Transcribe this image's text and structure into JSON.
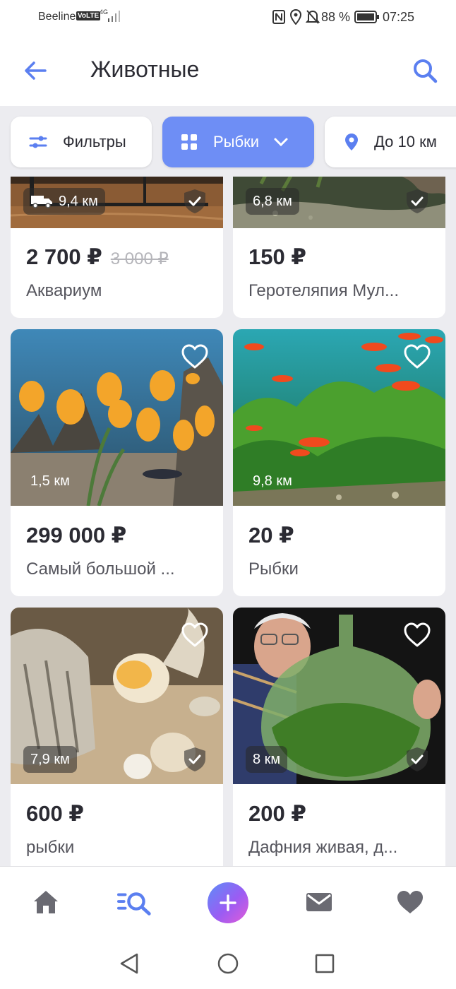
{
  "status_bar": {
    "carrier": "Beeline",
    "volte": "VoLTE",
    "network": "4G",
    "battery_percent": "88 %",
    "time": "07:25"
  },
  "toolbar": {
    "title": "Животные"
  },
  "chips": {
    "filters": "Фильтры",
    "category": "Рыбки",
    "distance": "До 10 км"
  },
  "listings": [
    {
      "distance": "9,4 км",
      "price": "2 700 ₽",
      "old_price": "3 000 ₽",
      "title": "Аквариум",
      "verified": true,
      "delivery": true
    },
    {
      "distance": "6,8 км",
      "price": "150 ₽",
      "title": "Геротеляпия Мул...",
      "verified": true
    },
    {
      "distance": "1,5 км",
      "price": "299 000 ₽",
      "title": "Самый большой ...",
      "favorite": false
    },
    {
      "distance": "9,8 км",
      "price": "20 ₽",
      "title": "Рыбки",
      "favorite": false
    },
    {
      "distance": "7,9 км",
      "price": "600 ₽",
      "title": "рыбки",
      "favorite": false,
      "verified": true
    },
    {
      "distance": "8 км",
      "price": "200 ₽",
      "title": "Дафния живая, д...",
      "favorite": false,
      "verified": true
    }
  ],
  "colors": {
    "accent": "#6e8ef5",
    "background": "#ececf0",
    "text": "#2b2b33"
  },
  "icons": {
    "back": "arrow-left-icon",
    "search": "search-icon",
    "filters": "sliders-icon",
    "category": "grid-icon",
    "location": "pin-icon",
    "heart": "heart-outline-icon",
    "verified": "shield-check-icon",
    "delivery": "truck-icon"
  },
  "bottom_nav": [
    "home-icon",
    "catalog-search-icon",
    "add-icon",
    "messages-icon",
    "favorites-icon"
  ]
}
